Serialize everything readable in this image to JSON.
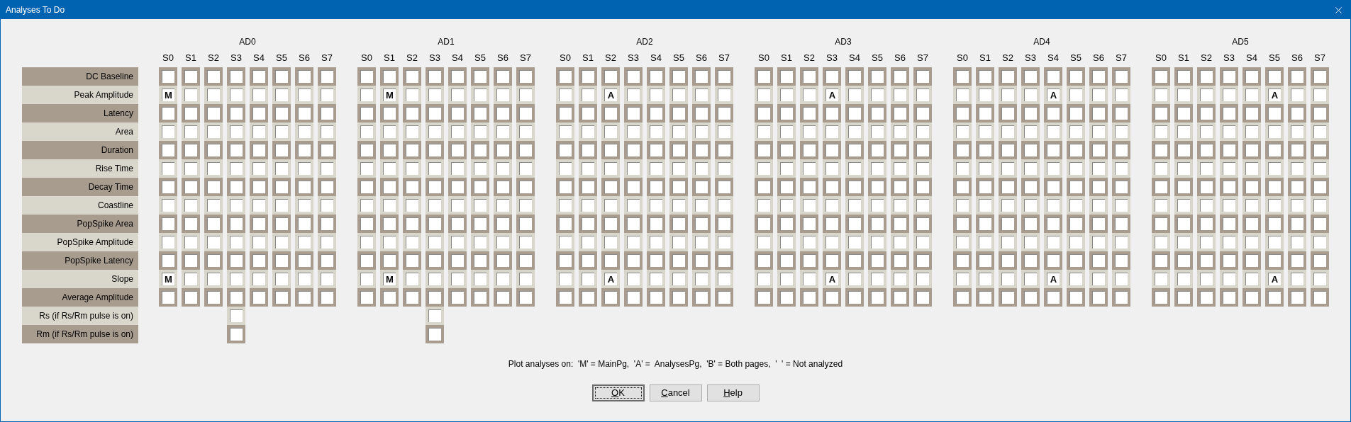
{
  "window": {
    "title": "Analyses To Do"
  },
  "groups": [
    {
      "label": "AD0",
      "columns": [
        "S0",
        "S1",
        "S2",
        "S3",
        "S4",
        "S5",
        "S6",
        "S7"
      ]
    },
    {
      "label": "AD1",
      "columns": [
        "S0",
        "S1",
        "S2",
        "S3",
        "S4",
        "S5",
        "S6",
        "S7"
      ]
    },
    {
      "label": "AD2",
      "columns": [
        "S0",
        "S1",
        "S2",
        "S3",
        "S4",
        "S5",
        "S6",
        "S7"
      ]
    },
    {
      "label": "AD3",
      "columns": [
        "S0",
        "S1",
        "S2",
        "S3",
        "S4",
        "S5",
        "S6",
        "S7"
      ]
    },
    {
      "label": "AD4",
      "columns": [
        "S0",
        "S1",
        "S2",
        "S3",
        "S4",
        "S5",
        "S6",
        "S7"
      ]
    },
    {
      "label": "AD5",
      "columns": [
        "S0",
        "S1",
        "S2",
        "S3",
        "S4",
        "S5",
        "S6",
        "S7"
      ]
    }
  ],
  "rows": [
    {
      "label": "DC Baseline",
      "cells": [
        [
          null,
          null,
          null,
          null,
          null,
          null,
          null,
          null
        ],
        [
          null,
          null,
          null,
          null,
          null,
          null,
          null,
          null
        ],
        [
          null,
          null,
          null,
          null,
          null,
          null,
          null,
          null
        ],
        [
          null,
          null,
          null,
          null,
          null,
          null,
          null,
          null
        ],
        [
          null,
          null,
          null,
          null,
          null,
          null,
          null,
          null
        ],
        [
          null,
          null,
          null,
          null,
          null,
          null,
          null,
          null
        ]
      ]
    },
    {
      "label": "Peak Amplitude",
      "cells": [
        [
          "M",
          null,
          null,
          null,
          null,
          null,
          null,
          null
        ],
        [
          null,
          "M",
          null,
          null,
          null,
          null,
          null,
          null
        ],
        [
          null,
          null,
          "A",
          null,
          null,
          null,
          null,
          null
        ],
        [
          null,
          null,
          null,
          "A",
          null,
          null,
          null,
          null
        ],
        [
          null,
          null,
          null,
          null,
          "A",
          null,
          null,
          null
        ],
        [
          null,
          null,
          null,
          null,
          null,
          "A",
          null,
          null
        ]
      ]
    },
    {
      "label": "Latency",
      "cells": [
        [
          null,
          null,
          null,
          null,
          null,
          null,
          null,
          null
        ],
        [
          null,
          null,
          null,
          null,
          null,
          null,
          null,
          null
        ],
        [
          null,
          null,
          null,
          null,
          null,
          null,
          null,
          null
        ],
        [
          null,
          null,
          null,
          null,
          null,
          null,
          null,
          null
        ],
        [
          null,
          null,
          null,
          null,
          null,
          null,
          null,
          null
        ],
        [
          null,
          null,
          null,
          null,
          null,
          null,
          null,
          null
        ]
      ]
    },
    {
      "label": "Area",
      "cells": [
        [
          null,
          null,
          null,
          null,
          null,
          null,
          null,
          null
        ],
        [
          null,
          null,
          null,
          null,
          null,
          null,
          null,
          null
        ],
        [
          null,
          null,
          null,
          null,
          null,
          null,
          null,
          null
        ],
        [
          null,
          null,
          null,
          null,
          null,
          null,
          null,
          null
        ],
        [
          null,
          null,
          null,
          null,
          null,
          null,
          null,
          null
        ],
        [
          null,
          null,
          null,
          null,
          null,
          null,
          null,
          null
        ]
      ]
    },
    {
      "label": "Duration",
      "cells": [
        [
          null,
          null,
          null,
          null,
          null,
          null,
          null,
          null
        ],
        [
          null,
          null,
          null,
          null,
          null,
          null,
          null,
          null
        ],
        [
          null,
          null,
          null,
          null,
          null,
          null,
          null,
          null
        ],
        [
          null,
          null,
          null,
          null,
          null,
          null,
          null,
          null
        ],
        [
          null,
          null,
          null,
          null,
          null,
          null,
          null,
          null
        ],
        [
          null,
          null,
          null,
          null,
          null,
          null,
          null,
          null
        ]
      ]
    },
    {
      "label": "Rise Time",
      "cells": [
        [
          null,
          null,
          null,
          null,
          null,
          null,
          null,
          null
        ],
        [
          null,
          null,
          null,
          null,
          null,
          null,
          null,
          null
        ],
        [
          null,
          null,
          null,
          null,
          null,
          null,
          null,
          null
        ],
        [
          null,
          null,
          null,
          null,
          null,
          null,
          null,
          null
        ],
        [
          null,
          null,
          null,
          null,
          null,
          null,
          null,
          null
        ],
        [
          null,
          null,
          null,
          null,
          null,
          null,
          null,
          null
        ]
      ]
    },
    {
      "label": "Decay Time",
      "cells": [
        [
          null,
          null,
          null,
          null,
          null,
          null,
          null,
          null
        ],
        [
          null,
          null,
          null,
          null,
          null,
          null,
          null,
          null
        ],
        [
          null,
          null,
          null,
          null,
          null,
          null,
          null,
          null
        ],
        [
          null,
          null,
          null,
          null,
          null,
          null,
          null,
          null
        ],
        [
          null,
          null,
          null,
          null,
          null,
          null,
          null,
          null
        ],
        [
          null,
          null,
          null,
          null,
          null,
          null,
          null,
          null
        ]
      ]
    },
    {
      "label": "Coastline",
      "cells": [
        [
          null,
          null,
          null,
          null,
          null,
          null,
          null,
          null
        ],
        [
          null,
          null,
          null,
          null,
          null,
          null,
          null,
          null
        ],
        [
          null,
          null,
          null,
          null,
          null,
          null,
          null,
          null
        ],
        [
          null,
          null,
          null,
          null,
          null,
          null,
          null,
          null
        ],
        [
          null,
          null,
          null,
          null,
          null,
          null,
          null,
          null
        ],
        [
          null,
          null,
          null,
          null,
          null,
          null,
          null,
          null
        ]
      ]
    },
    {
      "label": "PopSpike Area",
      "cells": [
        [
          null,
          null,
          null,
          null,
          null,
          null,
          null,
          null
        ],
        [
          null,
          null,
          null,
          null,
          null,
          null,
          null,
          null
        ],
        [
          null,
          null,
          null,
          null,
          null,
          null,
          null,
          null
        ],
        [
          null,
          null,
          null,
          null,
          null,
          null,
          null,
          null
        ],
        [
          null,
          null,
          null,
          null,
          null,
          null,
          null,
          null
        ],
        [
          null,
          null,
          null,
          null,
          null,
          null,
          null,
          null
        ]
      ]
    },
    {
      "label": "PopSpike Amplitude",
      "cells": [
        [
          null,
          null,
          null,
          null,
          null,
          null,
          null,
          null
        ],
        [
          null,
          null,
          null,
          null,
          null,
          null,
          null,
          null
        ],
        [
          null,
          null,
          null,
          null,
          null,
          null,
          null,
          null
        ],
        [
          null,
          null,
          null,
          null,
          null,
          null,
          null,
          null
        ],
        [
          null,
          null,
          null,
          null,
          null,
          null,
          null,
          null
        ],
        [
          null,
          null,
          null,
          null,
          null,
          null,
          null,
          null
        ]
      ]
    },
    {
      "label": "PopSpike Latency",
      "cells": [
        [
          null,
          null,
          null,
          null,
          null,
          null,
          null,
          null
        ],
        [
          null,
          null,
          null,
          null,
          null,
          null,
          null,
          null
        ],
        [
          null,
          null,
          null,
          null,
          null,
          null,
          null,
          null
        ],
        [
          null,
          null,
          null,
          null,
          null,
          null,
          null,
          null
        ],
        [
          null,
          null,
          null,
          null,
          null,
          null,
          null,
          null
        ],
        [
          null,
          null,
          null,
          null,
          null,
          null,
          null,
          null
        ]
      ]
    },
    {
      "label": "Slope",
      "cells": [
        [
          "M",
          null,
          null,
          null,
          null,
          null,
          null,
          null
        ],
        [
          null,
          "M",
          null,
          null,
          null,
          null,
          null,
          null
        ],
        [
          null,
          null,
          "A",
          null,
          null,
          null,
          null,
          null
        ],
        [
          null,
          null,
          null,
          "A",
          null,
          null,
          null,
          null
        ],
        [
          null,
          null,
          null,
          null,
          "A",
          null,
          null,
          null
        ],
        [
          null,
          null,
          null,
          null,
          null,
          "A",
          null,
          null
        ]
      ]
    },
    {
      "label": "Average Amplitude",
      "cells": [
        [
          null,
          null,
          null,
          null,
          null,
          null,
          null,
          null
        ],
        [
          null,
          null,
          null,
          null,
          null,
          null,
          null,
          null
        ],
        [
          null,
          null,
          null,
          null,
          null,
          null,
          null,
          null
        ],
        [
          null,
          null,
          null,
          null,
          null,
          null,
          null,
          null
        ],
        [
          null,
          null,
          null,
          null,
          null,
          null,
          null,
          null
        ],
        [
          null,
          null,
          null,
          null,
          null,
          null,
          null,
          null
        ]
      ]
    },
    {
      "label": "Rs (if Rs/Rm pulse is on)",
      "kind": "pulse",
      "cells": [
        null,
        null
      ]
    },
    {
      "label": "Rm (if Rs/Rm pulse is on)",
      "kind": "pulse",
      "cells": [
        null,
        null
      ]
    }
  ],
  "legend": "Plot analyses on:  'M' = MainPg,  'A' =  AnalysesPg,  'B' = Both pages,  '  ' = Not analyzed",
  "buttons": [
    {
      "label": "OK",
      "default": true
    },
    {
      "label": "Cancel",
      "default": false
    },
    {
      "label": "Help",
      "default": false
    }
  ]
}
